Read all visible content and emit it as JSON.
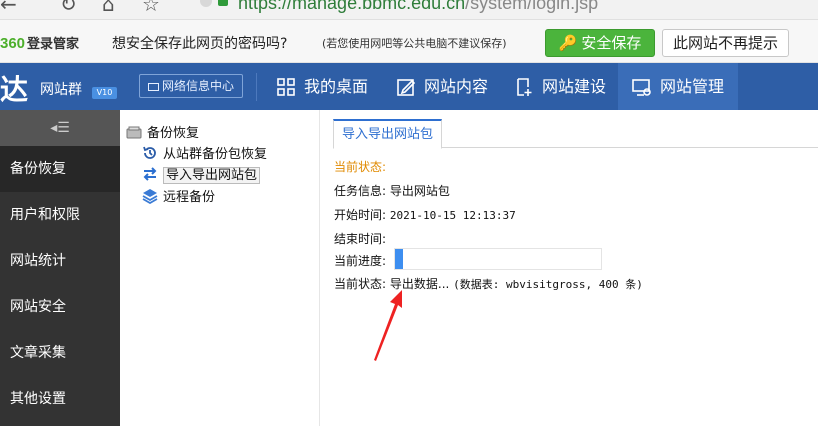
{
  "browser": {
    "url_host": "https://manage.bbmc.edu.cn",
    "url_path": "/system/login.jsp"
  },
  "password_bar": {
    "brand_prefix": "360",
    "brand_name": "登录管家",
    "question": "想安全保存此网页的密码吗?",
    "note": "(若您使用网吧等公共电脑不建议保存)",
    "save_label": "安全保存",
    "never_label": "此网站不再提示"
  },
  "header": {
    "logo_char": "达",
    "logo_text": "网站群",
    "version": "V10",
    "info_center": "网络信息中心",
    "nav": [
      {
        "label": "我的桌面",
        "icon": "grid-icon"
      },
      {
        "label": "网站内容",
        "icon": "edit-icon"
      },
      {
        "label": "网站建设",
        "icon": "add-page-icon"
      },
      {
        "label": "网站管理",
        "icon": "monitor-gear-icon",
        "active": true
      }
    ]
  },
  "sidebar": {
    "toggle": "◂☰",
    "items": [
      {
        "label": "备份恢复",
        "active": true
      },
      {
        "label": "用户和权限"
      },
      {
        "label": "网站统计"
      },
      {
        "label": "网站安全"
      },
      {
        "label": "文章采集"
      },
      {
        "label": "其他设置"
      }
    ]
  },
  "tree": {
    "root": "备份恢复",
    "children": [
      {
        "label": "从站群备份包恢复"
      },
      {
        "label": "导入导出网站包",
        "selected": true
      },
      {
        "label": "远程备份"
      }
    ]
  },
  "main": {
    "tab": "导入导出网站包",
    "status_heading": "当前状态:",
    "task_label": "任务信息:",
    "task_value": "导出网站包",
    "start_label": "开始时间:",
    "start_value": "2021-10-15 12:13:37",
    "end_label": "结束时间:",
    "end_value": "",
    "progress_label": "当前进度:",
    "progress_fraction": 0.04,
    "state_label": "当前状态:",
    "state_value": "导出数据...",
    "state_detail": "(数据表: wbvisitgross, 400 条)"
  },
  "colors": {
    "header_bg": "#2e5ea6",
    "sidebar_bg": "#333333",
    "accent": "#2e6fd0",
    "progress": "#3d8ef0",
    "annotation_arrow": "#ee2222"
  }
}
